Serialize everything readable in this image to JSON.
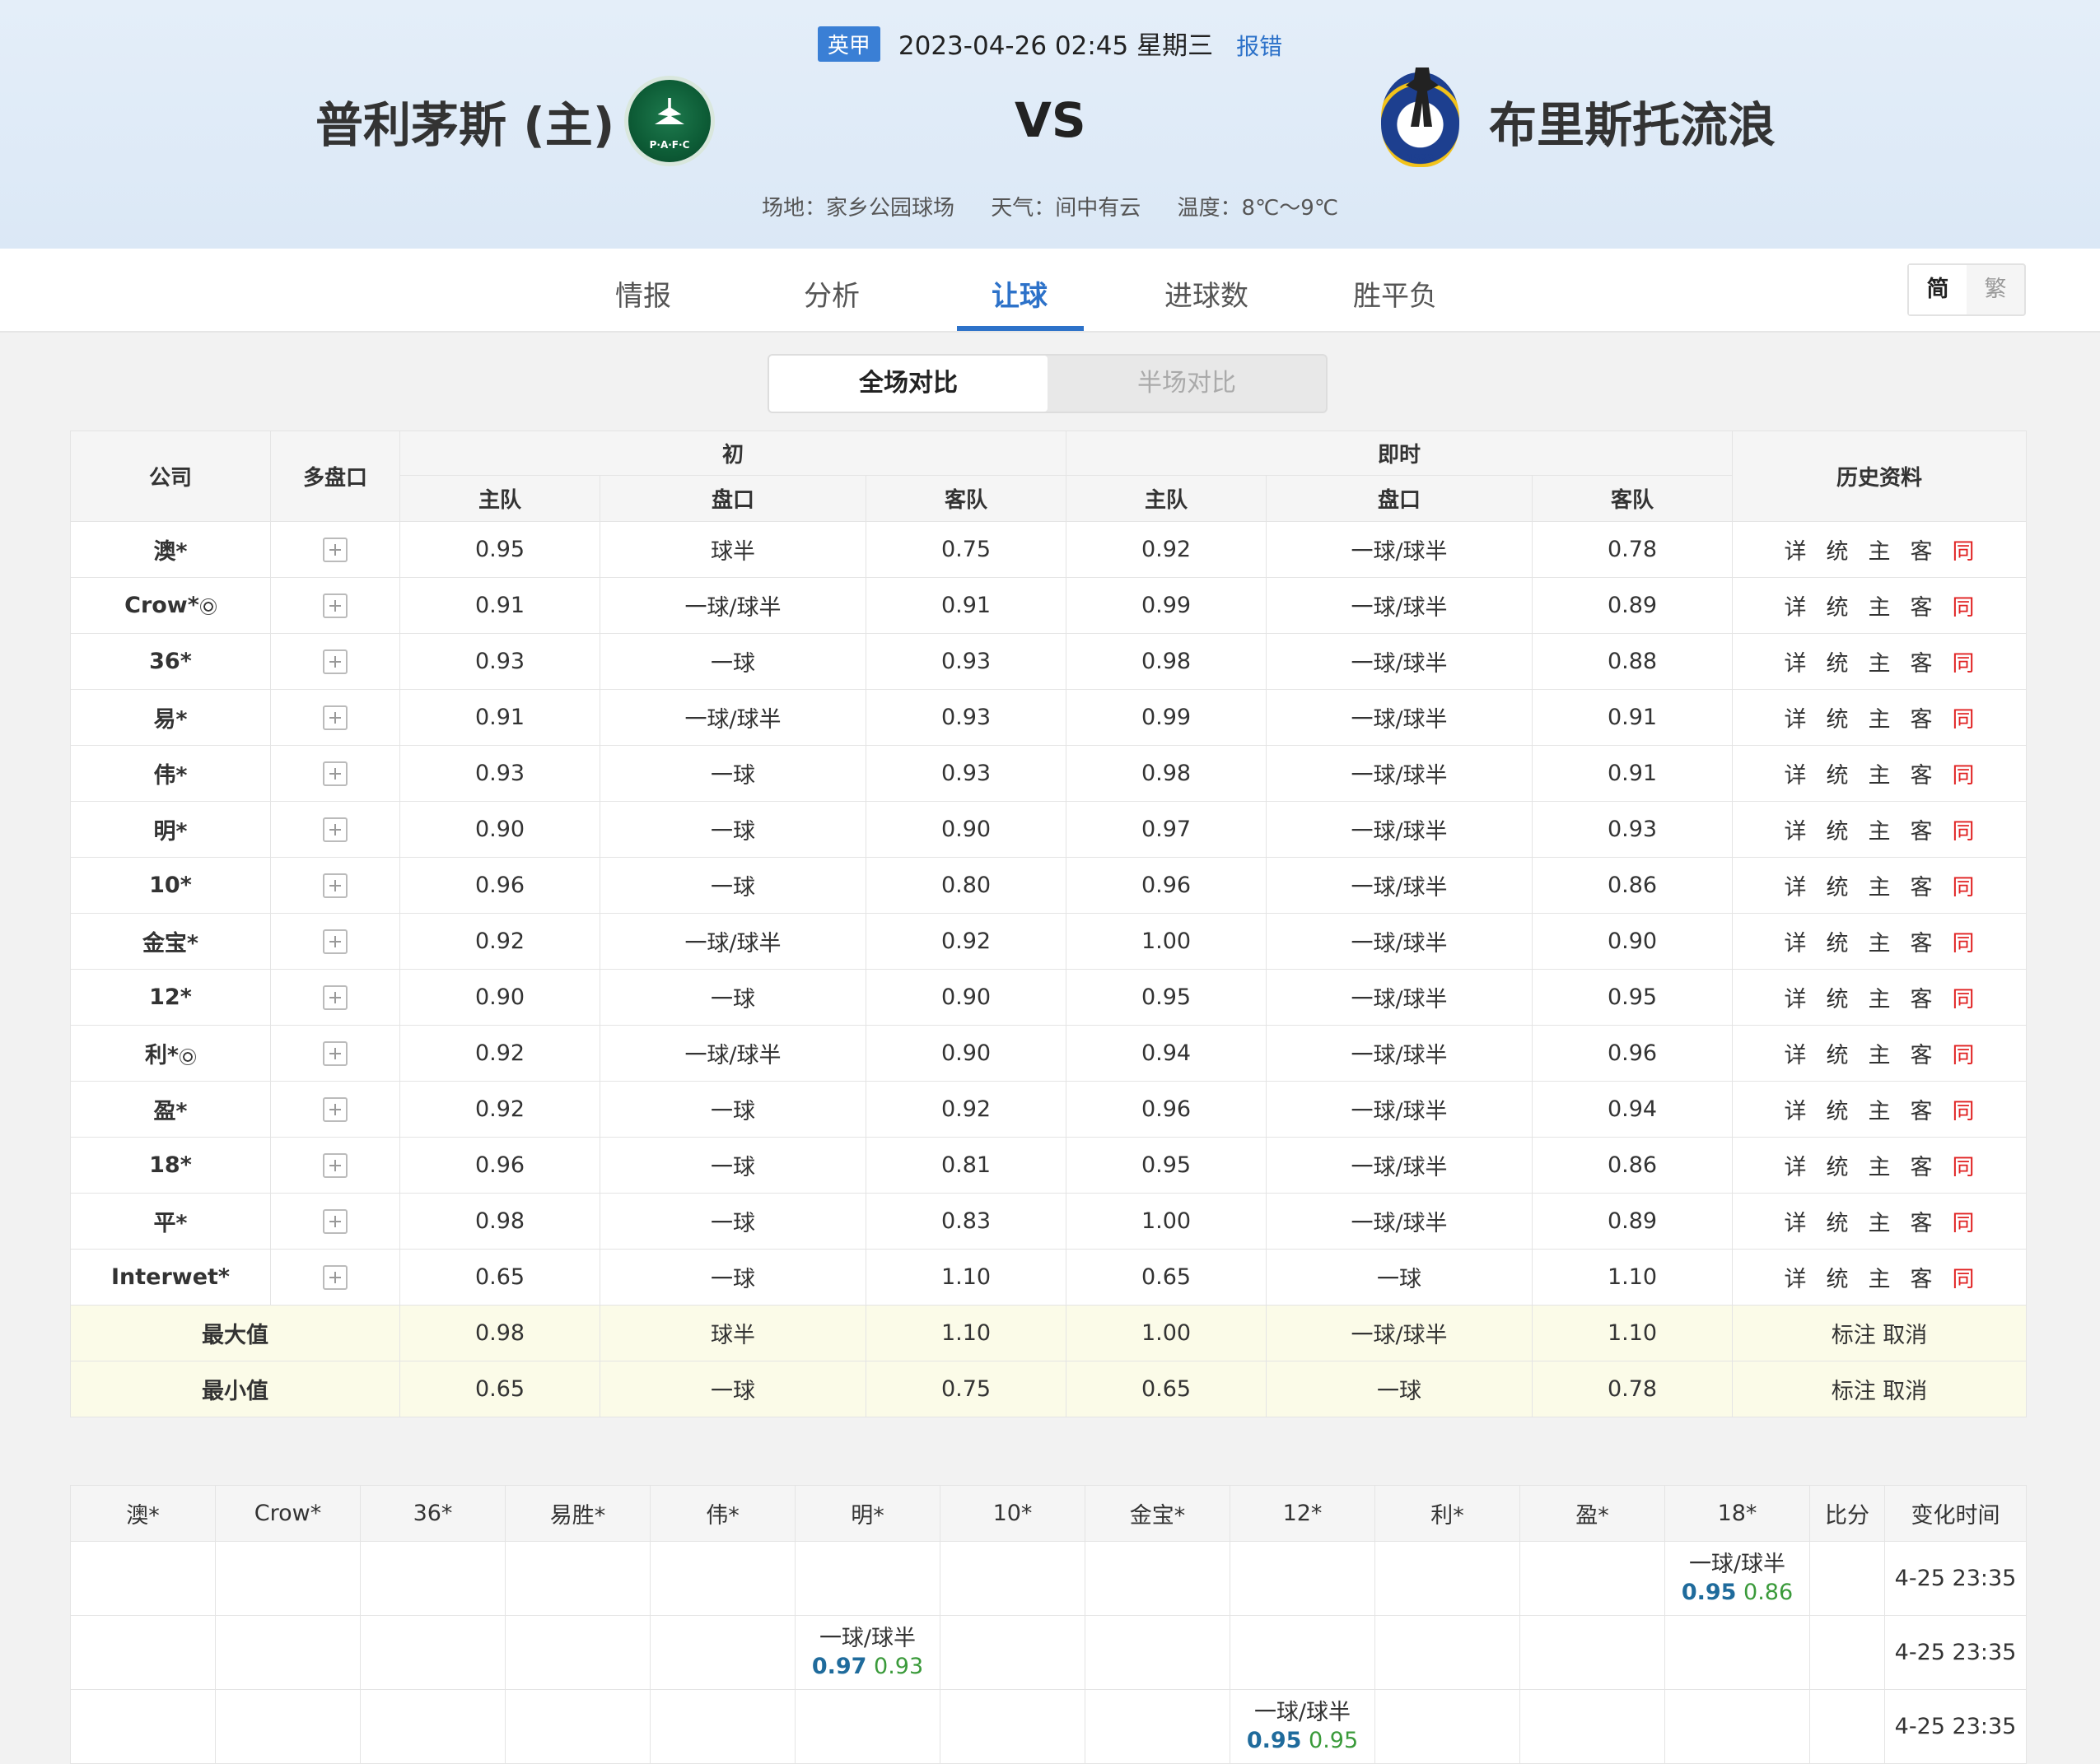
{
  "match": {
    "league": "英甲",
    "datetime": "2023-04-26 02:45 星期三",
    "report_error": "报错",
    "home_team": "普利茅斯 (主)",
    "away_team": "布里斯托流浪",
    "vs": "VS",
    "venue": "场地：家乡公园球场",
    "weather": "天气：间中有云",
    "temperature": "温度：8℃～9℃"
  },
  "nav": {
    "tabs": [
      "情报",
      "分析",
      "让球",
      "进球数",
      "胜平负"
    ],
    "active_tab": "让球",
    "lang_simplified": "简",
    "lang_traditional": "繁"
  },
  "toggle": {
    "full": "全场对比",
    "half": "半场对比"
  },
  "table": {
    "headers": {
      "company": "公司",
      "multi": "多盘口",
      "initial": "初",
      "live": "即时",
      "history": "历史资料",
      "home": "主队",
      "handicap": "盘口",
      "away": "客队"
    },
    "history_links": [
      "详",
      "统",
      "主",
      "客",
      "同"
    ],
    "rows": [
      {
        "company": "澳*",
        "ball": false,
        "i_home": "0.95",
        "i_hc": "球半",
        "i_away": "0.75",
        "l_home": "0.92",
        "l_hc": "一球/球半",
        "l_away": "0.78"
      },
      {
        "company": "Crow*",
        "ball": true,
        "i_home": "0.91",
        "i_hc": "一球/球半",
        "i_away": "0.91",
        "l_home": "0.99",
        "l_hc": "一球/球半",
        "l_away": "0.89"
      },
      {
        "company": "36*",
        "ball": false,
        "i_home": "0.93",
        "i_hc": "一球",
        "i_away": "0.93",
        "l_home": "0.98",
        "l_hc": "一球/球半",
        "l_away": "0.88"
      },
      {
        "company": "易*",
        "ball": false,
        "i_home": "0.91",
        "i_hc": "一球/球半",
        "i_away": "0.93",
        "l_home": "0.99",
        "l_hc": "一球/球半",
        "l_away": "0.91"
      },
      {
        "company": "伟*",
        "ball": false,
        "i_home": "0.93",
        "i_hc": "一球",
        "i_away": "0.93",
        "l_home": "0.98",
        "l_hc": "一球/球半",
        "l_away": "0.91"
      },
      {
        "company": "明*",
        "ball": false,
        "i_home": "0.90",
        "i_hc": "一球",
        "i_away": "0.90",
        "l_home": "0.97",
        "l_hc": "一球/球半",
        "l_away": "0.93"
      },
      {
        "company": "10*",
        "ball": false,
        "i_home": "0.96",
        "i_hc": "一球",
        "i_away": "0.80",
        "l_home": "0.96",
        "l_hc": "一球/球半",
        "l_away": "0.86"
      },
      {
        "company": "金宝*",
        "ball": false,
        "i_home": "0.92",
        "i_hc": "一球/球半",
        "i_away": "0.92",
        "l_home": "1.00",
        "l_hc": "一球/球半",
        "l_away": "0.90"
      },
      {
        "company": "12*",
        "ball": false,
        "i_home": "0.90",
        "i_hc": "一球",
        "i_away": "0.90",
        "l_home": "0.95",
        "l_hc": "一球/球半",
        "l_away": "0.95"
      },
      {
        "company": "利*",
        "ball": true,
        "i_home": "0.92",
        "i_hc": "一球/球半",
        "i_away": "0.90",
        "l_home": "0.94",
        "l_hc": "一球/球半",
        "l_away": "0.96"
      },
      {
        "company": "盈*",
        "ball": false,
        "i_home": "0.92",
        "i_hc": "一球",
        "i_away": "0.92",
        "l_home": "0.96",
        "l_hc": "一球/球半",
        "l_away": "0.94"
      },
      {
        "company": "18*",
        "ball": false,
        "i_home": "0.96",
        "i_hc": "一球",
        "i_away": "0.81",
        "l_home": "0.95",
        "l_hc": "一球/球半",
        "l_away": "0.86"
      },
      {
        "company": "平*",
        "ball": false,
        "i_home": "0.98",
        "i_hc": "一球",
        "i_away": "0.83",
        "l_home": "1.00",
        "l_hc": "一球/球半",
        "l_away": "0.89"
      },
      {
        "company": "Interwet*",
        "ball": false,
        "i_home": "0.65",
        "i_hc": "一球",
        "i_away": "1.10",
        "l_home": "0.65",
        "l_hc": "一球",
        "l_away": "1.10"
      }
    ],
    "summary": [
      {
        "label": "最大值",
        "i_home": "0.98",
        "i_hc": "球半",
        "i_away": "1.10",
        "l_home": "1.00",
        "l_hc": "一球/球半",
        "l_away": "1.10",
        "action": "标注 取消"
      },
      {
        "label": "最小值",
        "i_home": "0.65",
        "i_hc": "一球",
        "i_away": "0.75",
        "l_home": "0.65",
        "l_hc": "一球",
        "l_away": "0.78",
        "action": "标注 取消"
      }
    ]
  },
  "changes": {
    "headers": [
      "澳*",
      "Crow*",
      "36*",
      "易胜*",
      "伟*",
      "明*",
      "10*",
      "金宝*",
      "12*",
      "利*",
      "盈*",
      "18*",
      "比分",
      "变化时间"
    ],
    "rows": [
      {
        "col": 11,
        "handicap": "一球/球半",
        "home": "0.95",
        "away": "0.86",
        "time": "4-25 23:35"
      },
      {
        "col": 5,
        "handicap": "一球/球半",
        "home": "0.97",
        "away": "0.93",
        "time": "4-25 23:35"
      },
      {
        "col": 8,
        "handicap": "一球/球半",
        "home": "0.95",
        "away": "0.95",
        "time": "4-25 23:35"
      }
    ]
  }
}
